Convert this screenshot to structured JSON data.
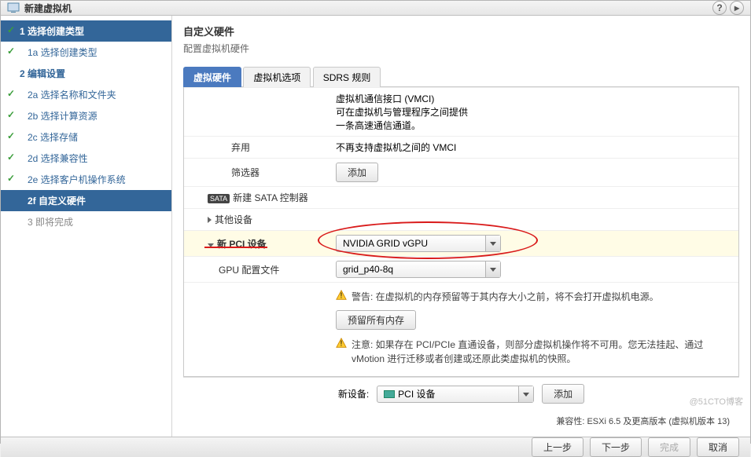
{
  "title": "新建虚拟机",
  "sidebar": {
    "s1": {
      "label": "1 选择创建类型"
    },
    "s1a": {
      "label": "1a 选择创建类型"
    },
    "s2": {
      "label": "2 编辑设置"
    },
    "s2a": {
      "label": "2a 选择名称和文件夹"
    },
    "s2b": {
      "label": "2b 选择计算资源"
    },
    "s2c": {
      "label": "2c 选择存储"
    },
    "s2d": {
      "label": "2d 选择兼容性"
    },
    "s2e": {
      "label": "2e 选择客户机操作系统"
    },
    "s2f": {
      "label": "2f 自定义硬件"
    },
    "s3": {
      "label": "3 即将完成"
    }
  },
  "header": {
    "title": "自定义硬件",
    "subtitle": "配置虚拟机硬件"
  },
  "tabs": {
    "hw": "虚拟硬件",
    "opt": "虚拟机选项",
    "sdrs": "SDRS 规则"
  },
  "vmci": {
    "title": "虚拟机通信接口 (VMCI)",
    "line2": "可在虚拟机与管理程序之间提供",
    "line3": "一条高速通信通道。"
  },
  "rows": {
    "deprecated": {
      "label": "弃用",
      "text": "不再支持虚拟机之间的 VMCI"
    },
    "filter": {
      "label": "筛选器",
      "btn": "添加"
    },
    "sata": {
      "label": "新建 SATA 控制器",
      "badge": "SATA"
    },
    "other": {
      "label": "其他设备"
    },
    "pci": {
      "label": "新 PCI 设备",
      "value": "NVIDIA GRID vGPU"
    },
    "gpuprof": {
      "label": "GPU 配置文件",
      "value": "grid_p40-8q"
    }
  },
  "warnings": {
    "w1": "警告: 在虚拟机的内存预留等于其内存大小之前，将不会打开虚拟机电源。",
    "reserve_btn": "预留所有内存",
    "w2": "注意: 如果存在 PCI/PCIe 直通设备，则部分虚拟机操作将不可用。您无法挂起、通过 vMotion 进行迁移或者创建或还原此类虚拟机的快照。"
  },
  "newdev": {
    "label": "新设备:",
    "value": "PCI 设备",
    "add": "添加"
  },
  "compat": "兼容性: ESXi 6.5 及更高版本 (虚拟机版本 13)",
  "footer": {
    "back": "上一步",
    "next": "下一步",
    "finish": "完成",
    "cancel": "取消"
  },
  "watermark": "@51CTO博客"
}
